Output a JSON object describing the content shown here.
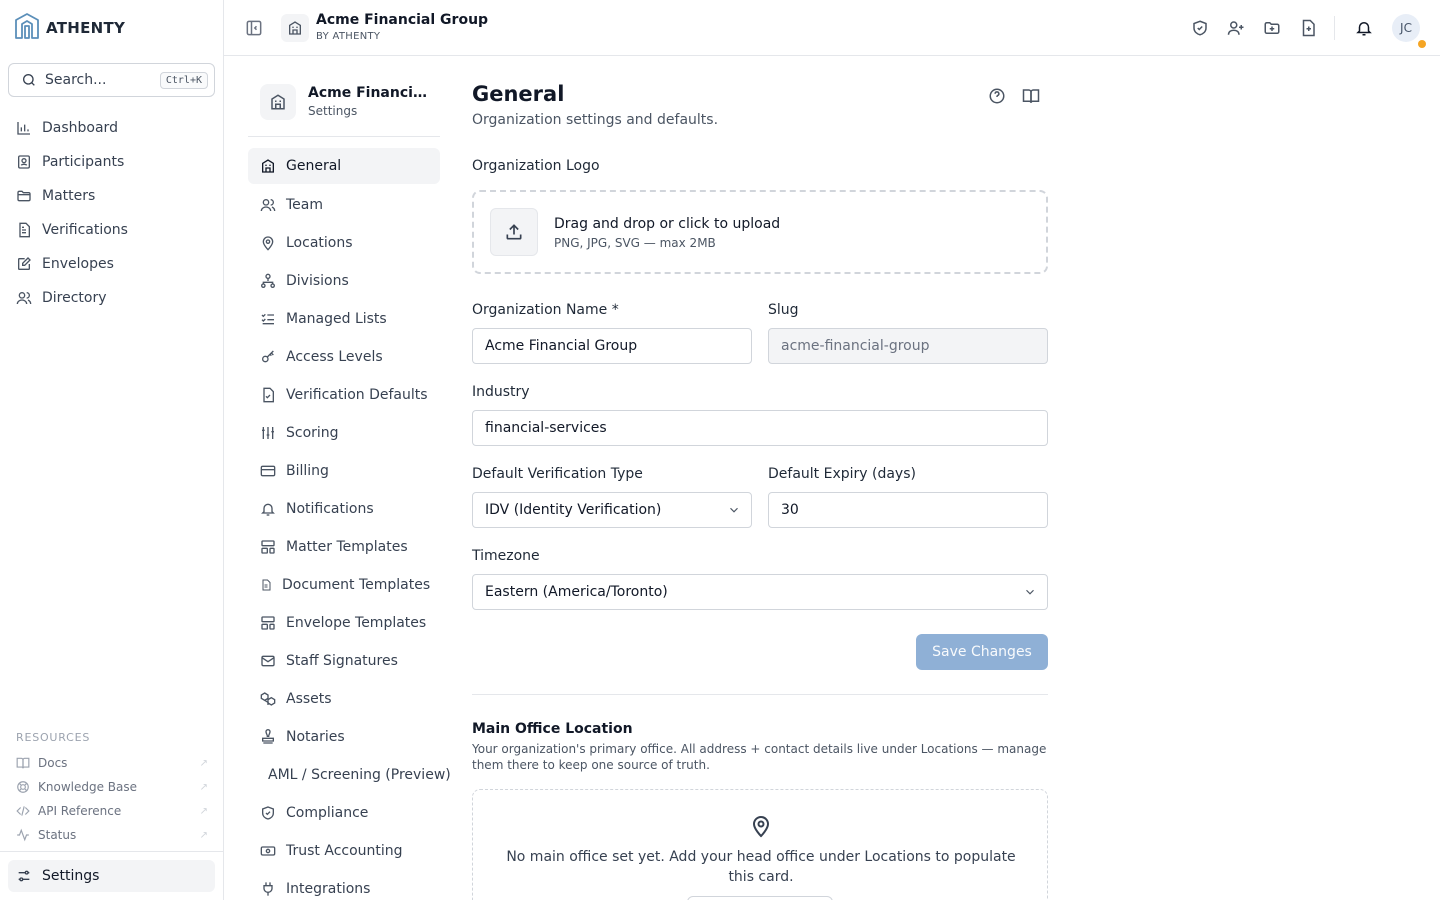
{
  "brand": {
    "name": "ATHENTY"
  },
  "search": {
    "placeholder": "Search...",
    "shortcut": "Ctrl+K"
  },
  "nav": [
    {
      "label": "Dashboard",
      "icon": "chart-bar-icon"
    },
    {
      "label": "Participants",
      "icon": "id-card-icon"
    },
    {
      "label": "Matters",
      "icon": "folder-icon"
    },
    {
      "label": "Verifications",
      "icon": "document-icon"
    },
    {
      "label": "Envelopes",
      "icon": "signature-icon"
    },
    {
      "label": "Directory",
      "icon": "users-icon"
    }
  ],
  "resources": {
    "label": "RESOURCES",
    "items": [
      {
        "label": "Docs",
        "icon": "book-icon"
      },
      {
        "label": "Knowledge Base",
        "icon": "lifebuoy-icon"
      },
      {
        "label": "API Reference",
        "icon": "code-icon"
      },
      {
        "label": "Status",
        "icon": "pulse-icon"
      }
    ]
  },
  "settings_nav": {
    "label": "Settings"
  },
  "topbar": {
    "org_name": "Acme Financial Group",
    "org_sub": "BY ATHENTY",
    "user_initials": "JC",
    "colors": {
      "status_dot": "#f5a524"
    }
  },
  "org_card": {
    "name": "Acme Financial Group",
    "sub": "Settings"
  },
  "subnav": [
    {
      "label": "General",
      "active": true
    },
    {
      "label": "Team"
    },
    {
      "label": "Locations"
    },
    {
      "label": "Divisions"
    },
    {
      "label": "Managed Lists"
    },
    {
      "label": "Access Levels"
    },
    {
      "label": "Verification Defaults"
    },
    {
      "label": "Scoring"
    },
    {
      "label": "Billing"
    },
    {
      "label": "Notifications"
    },
    {
      "label": "Matter Templates"
    },
    {
      "label": "Document Templates"
    },
    {
      "label": "Envelope Templates"
    },
    {
      "label": "Staff Signatures"
    },
    {
      "label": "Assets"
    },
    {
      "label": "Notaries"
    },
    {
      "label": "AML / Screening (Preview)"
    },
    {
      "label": "Compliance"
    },
    {
      "label": "Trust Accounting"
    },
    {
      "label": "Integrations"
    }
  ],
  "page": {
    "title": "General",
    "subtitle": "Organization settings and defaults."
  },
  "form": {
    "logo_label": "Organization Logo",
    "upload_title": "Drag and drop or click to upload",
    "upload_hint": "PNG, JPG, SVG — max 2MB",
    "org_name_label": "Organization Name *",
    "org_name_value": "Acme Financial Group",
    "slug_label": "Slug",
    "slug_value": "acme-financial-group",
    "industry_label": "Industry",
    "industry_value": "financial-services",
    "ver_type_label": "Default Verification Type",
    "ver_type_value": "IDV (Identity Verification)",
    "expiry_label": "Default Expiry (days)",
    "expiry_value": "30",
    "timezone_label": "Timezone",
    "timezone_value": "Eastern (America/Toronto)",
    "save_label": "Save Changes",
    "colors": {
      "save_button": "#8fb0d6"
    }
  },
  "office": {
    "title": "Main Office Location",
    "desc": "Your organization's primary office. All address + contact details live under Locations — manage them there to keep one source of truth.",
    "empty_msg": "No main office set yet. Add your head office under Locations to populate this card."
  }
}
